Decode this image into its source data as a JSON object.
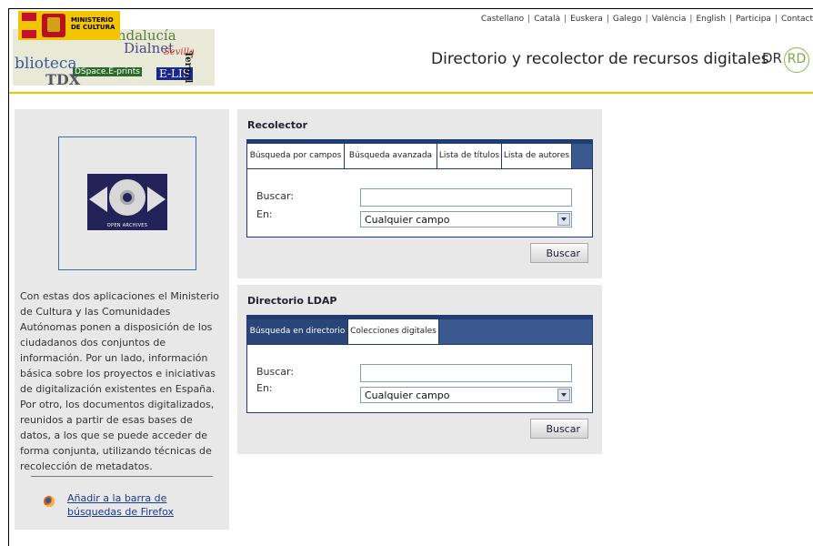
{
  "languages": [
    "Castellano",
    "Català",
    "Euskera",
    "Galego",
    "València",
    "English",
    "Participa",
    "Contact"
  ],
  "logo": {
    "ministerio_line1": "MINISTERIO",
    "ministerio_line2": "DE CULTURA",
    "collage_words": [
      "Andalucía",
      "Dialnet",
      "Sevilla",
      "blioteca",
      "DSpace.E-prints",
      "E-LIS",
      "TDX",
      "Tesis",
      "Teruel"
    ]
  },
  "header": {
    "title": "Directorio y recolector de recursos digitales",
    "dr_text": "DR",
    "rd_text": "RD",
    "accent_color": "#f3c400"
  },
  "sidebar": {
    "image_caption": "OPEN ARCHIVES",
    "description": "Con estas dos aplicaciones el Ministerio de Cultura y las Comunidades Autónomas ponen a disposición de los ciudadanos dos conjuntos de información. Por un lado, información básica sobre los proyectos e iniciativas de digitalización existentes en España. Por otro, los documentos digitalizados, reunidos a partir de esas bases de datos, a los que se puede acceder de forma conjunta, utilizando técnicas de recolección de metadatos.",
    "firefox_link": "Añadir a la barra de búsquedas de Firefox"
  },
  "recolector": {
    "title": "Recolector",
    "tabs": [
      "Búsqueda por campos",
      "Búsqueda avanzada",
      "Lista de títulos",
      "Lista de autores"
    ],
    "buscar_label": "Buscar:",
    "buscar_value": "",
    "en_label": "En:",
    "en_value": "Cualquier campo",
    "submit_label": "Buscar"
  },
  "ldap": {
    "title": "Directorio LDAP",
    "tabs": [
      "Búsqueda en directorio",
      "Colecciones digitales"
    ],
    "buscar_label": "Buscar:",
    "buscar_value": "",
    "en_label": "En:",
    "en_value": "Cualquier campo",
    "submit_label": "Buscar"
  }
}
